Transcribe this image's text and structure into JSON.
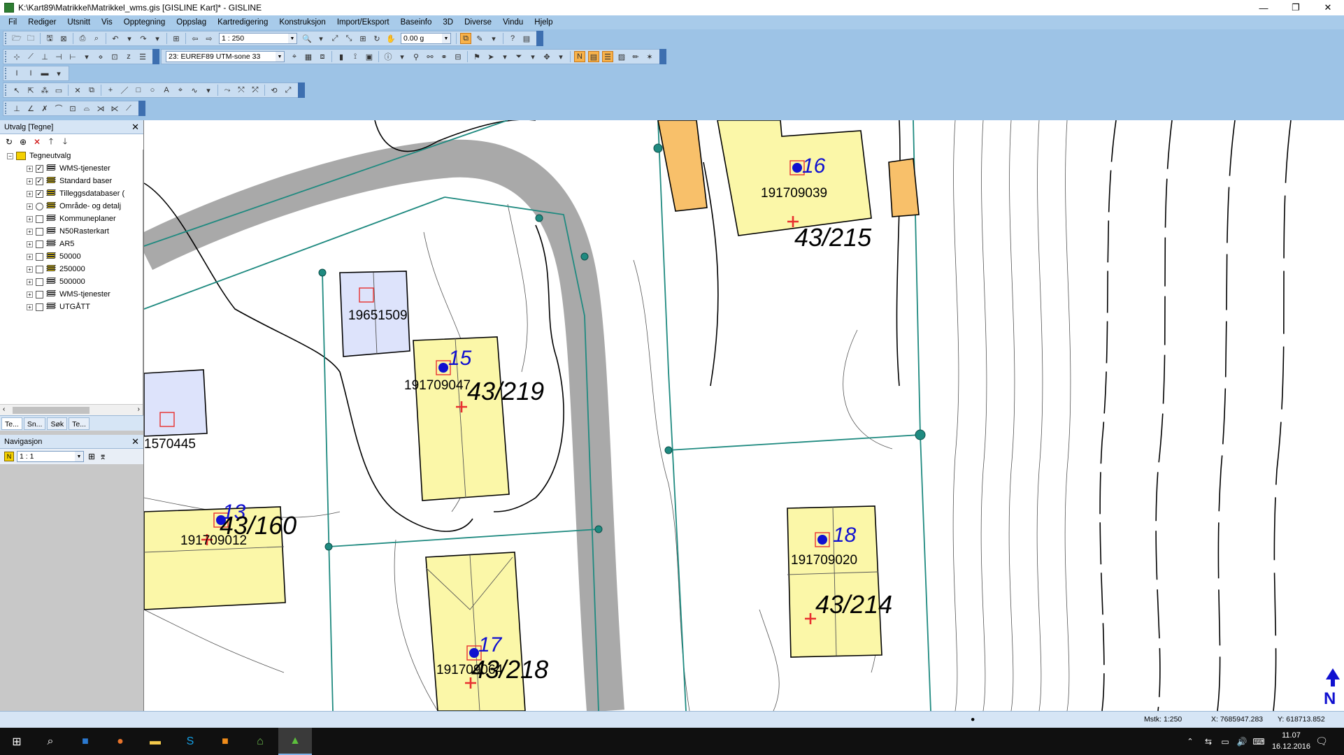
{
  "window": {
    "title": "K:\\Kart89\\Matrikkel\\Matrikkel_wms.gis [GISLINE Kart]* - GISLINE",
    "min": "—",
    "max": "❐",
    "close": "✕"
  },
  "menu": [
    "Fil",
    "Rediger",
    "Utsnitt",
    "Vis",
    "Opptegning",
    "Oppslag",
    "Kartredigering",
    "Konstruksjon",
    "Import/Eksport",
    "Baseinfo",
    "3D",
    "Diverse",
    "Vindu",
    "Hjelp"
  ],
  "toolbar": {
    "scale_value": "1 : 250",
    "angle_value": "0.00 g",
    "projection_value": "23: EUREF89 UTM-sone 33"
  },
  "left_panel": {
    "title": "Utvalg [Tegne]",
    "tree_root": "Tegneutvalg",
    "layers": [
      {
        "label": "WMS-tjenester",
        "checked": true
      },
      {
        "label": "Standard baser",
        "checked": true
      },
      {
        "label": "Tilleggsdatabaser (",
        "checked": true
      },
      {
        "label": "Område- og detalj",
        "checked": false
      },
      {
        "label": "Kommuneplaner",
        "checked": false
      },
      {
        "label": "N50Rasterkart",
        "checked": false
      },
      {
        "label": "AR5",
        "checked": false
      },
      {
        "label": "50000",
        "checked": false
      },
      {
        "label": "250000",
        "checked": false
      },
      {
        "label": "500000",
        "checked": false
      },
      {
        "label": "WMS-tjenester",
        "checked": false
      },
      {
        "label": "UTGÅTT",
        "checked": false
      }
    ],
    "tabs": [
      "Te...",
      "Sn...",
      "Søk",
      "Te..."
    ],
    "nav_title": "Navigasjon",
    "nav_scale": "1 : 1"
  },
  "map": {
    "buildings": [
      {
        "id": "191709039",
        "number": "16"
      },
      {
        "id": "19651509"
      },
      {
        "id": "191709047",
        "number": "15"
      },
      {
        "id": "1570445"
      },
      {
        "id": "191709012",
        "number": "13"
      },
      {
        "id": "191709020",
        "number": "18"
      },
      {
        "id": "191709064",
        "number": "17"
      }
    ],
    "parcels": [
      "43/215",
      "43/219",
      "43/160",
      "43/214",
      "43/218"
    ],
    "north_label": "N"
  },
  "status": {
    "scale": "Mstk:  1:250",
    "x": "X:  7685947.283",
    "y": "Y:  618713.852"
  },
  "taskbar": {
    "time": "11.07",
    "date": "16.12.2016"
  },
  "colors": {
    "chrome": "#9dc3e6",
    "building_yellow": "#fbf7a8",
    "building_blue": "#dde3fb",
    "building_orange": "#f8c06a",
    "road": "#a9a9a9",
    "teal_line": "#1f8a80"
  }
}
